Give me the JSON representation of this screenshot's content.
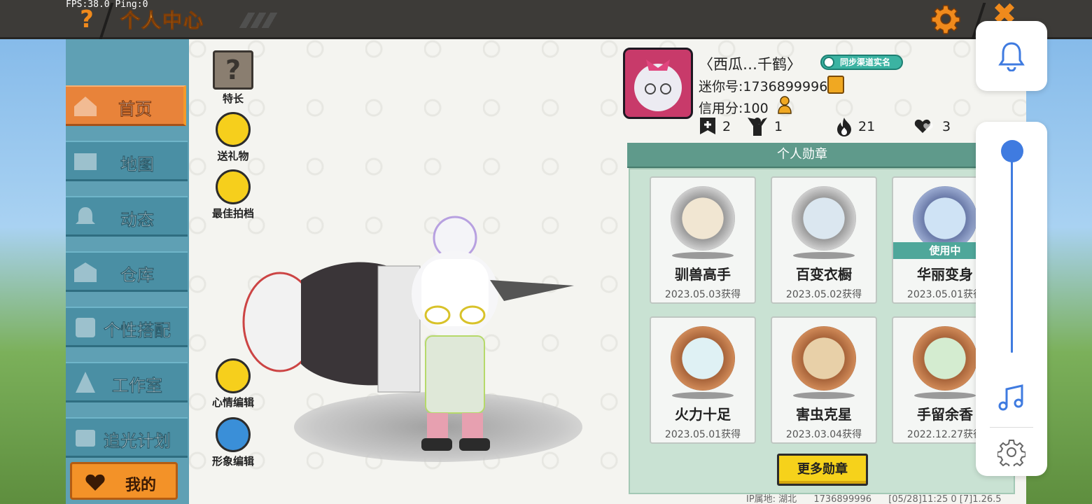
{
  "debug": {
    "fps_ping": "FPS:38.0  Ping:0"
  },
  "header": {
    "help_icon": "?",
    "title": "个人中心",
    "close_icon": "✖"
  },
  "sidebar": {
    "items": [
      {
        "label": "首页",
        "icon": "house-icon",
        "active": true
      },
      {
        "label": "地图",
        "icon": "map-icon",
        "active": false
      },
      {
        "label": "动态",
        "icon": "bell-icon",
        "active": false
      },
      {
        "label": "仓库",
        "icon": "warehouse-icon",
        "active": false
      },
      {
        "label": "个性搭配",
        "icon": "outfit-icon",
        "active": false
      },
      {
        "label": "工作室",
        "icon": "studio-icon",
        "active": false
      },
      {
        "label": "追光计划",
        "icon": "light-plan-icon",
        "active": false
      }
    ],
    "mine_label": "我的"
  },
  "actions": {
    "specialty": "特长",
    "send_gift": "送礼物",
    "best_shot": "最佳拍档",
    "mood_edit": "心情编辑",
    "image_edit": "形象编辑"
  },
  "profile": {
    "nickname": "〈西瓜…千鹤〉",
    "sync_badge": "同步渠道实名",
    "mini_id": "迷你号:1736899996",
    "credit": "信用分:100",
    "stats": {
      "follows": "2",
      "fans": "1",
      "heat": "21",
      "likes": "3"
    }
  },
  "medals": {
    "header": "个人勋章",
    "items": [
      {
        "name": "驯兽高手",
        "date": "2023.05.03获得",
        "in_use": ""
      },
      {
        "name": "百变衣橱",
        "date": "2023.05.02获得",
        "in_use": ""
      },
      {
        "name": "华丽变身",
        "date": "2023.05.01获得",
        "in_use": "使用中"
      },
      {
        "name": "火力十足",
        "date": "2023.05.01获得",
        "in_use": ""
      },
      {
        "name": "害虫克星",
        "date": "2023.03.04获得",
        "in_use": ""
      },
      {
        "name": "手留余香",
        "date": "2022.12.27获得",
        "in_use": ""
      }
    ],
    "more_label": "更多勋章"
  },
  "footer": {
    "ip": "IP属地: 湖北",
    "uid": "1736899996",
    "time": "[05/28]11:25 0  [7]1.26.5"
  },
  "colors": {
    "accent": "#f39a2a",
    "sidebar": "#4a8fa4",
    "medal_bg": "#c9e2d3",
    "button_yellow": "#f6d21b",
    "volume_blue": "#3f7be0"
  }
}
